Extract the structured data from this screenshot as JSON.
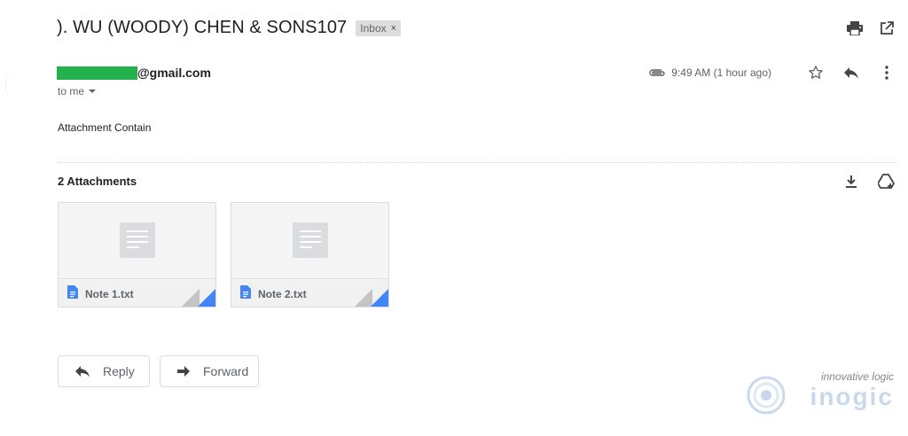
{
  "email": {
    "subject": "). WU (WOODY) CHEN & SONS107",
    "label_chip": "Inbox",
    "label_chip_close": "×",
    "sender_suffix": "@gmail.com",
    "recipient": "to me",
    "time": "9:49 AM (1 hour ago)",
    "body": "Attachment Contain"
  },
  "attachments": {
    "title": "2 Attachments",
    "items": [
      {
        "name": "Note 1.txt"
      },
      {
        "name": "Note 2.txt"
      }
    ]
  },
  "actions": {
    "reply_label": "Reply",
    "forward_label": "Forward"
  },
  "watermark": {
    "tagline": "innovative logic",
    "brand": "inogic"
  },
  "colors": {
    "redaction": "#22b14c",
    "chip_bg": "#dddddd",
    "doc_blue": "#4285f4"
  },
  "icons": [
    "print-icon",
    "open-in-new-window-icon",
    "paperclip-icon",
    "star-icon",
    "reply-icon",
    "more-vertical-icon",
    "download-icon",
    "add-to-drive-icon",
    "document-icon",
    "forward-icon"
  ]
}
